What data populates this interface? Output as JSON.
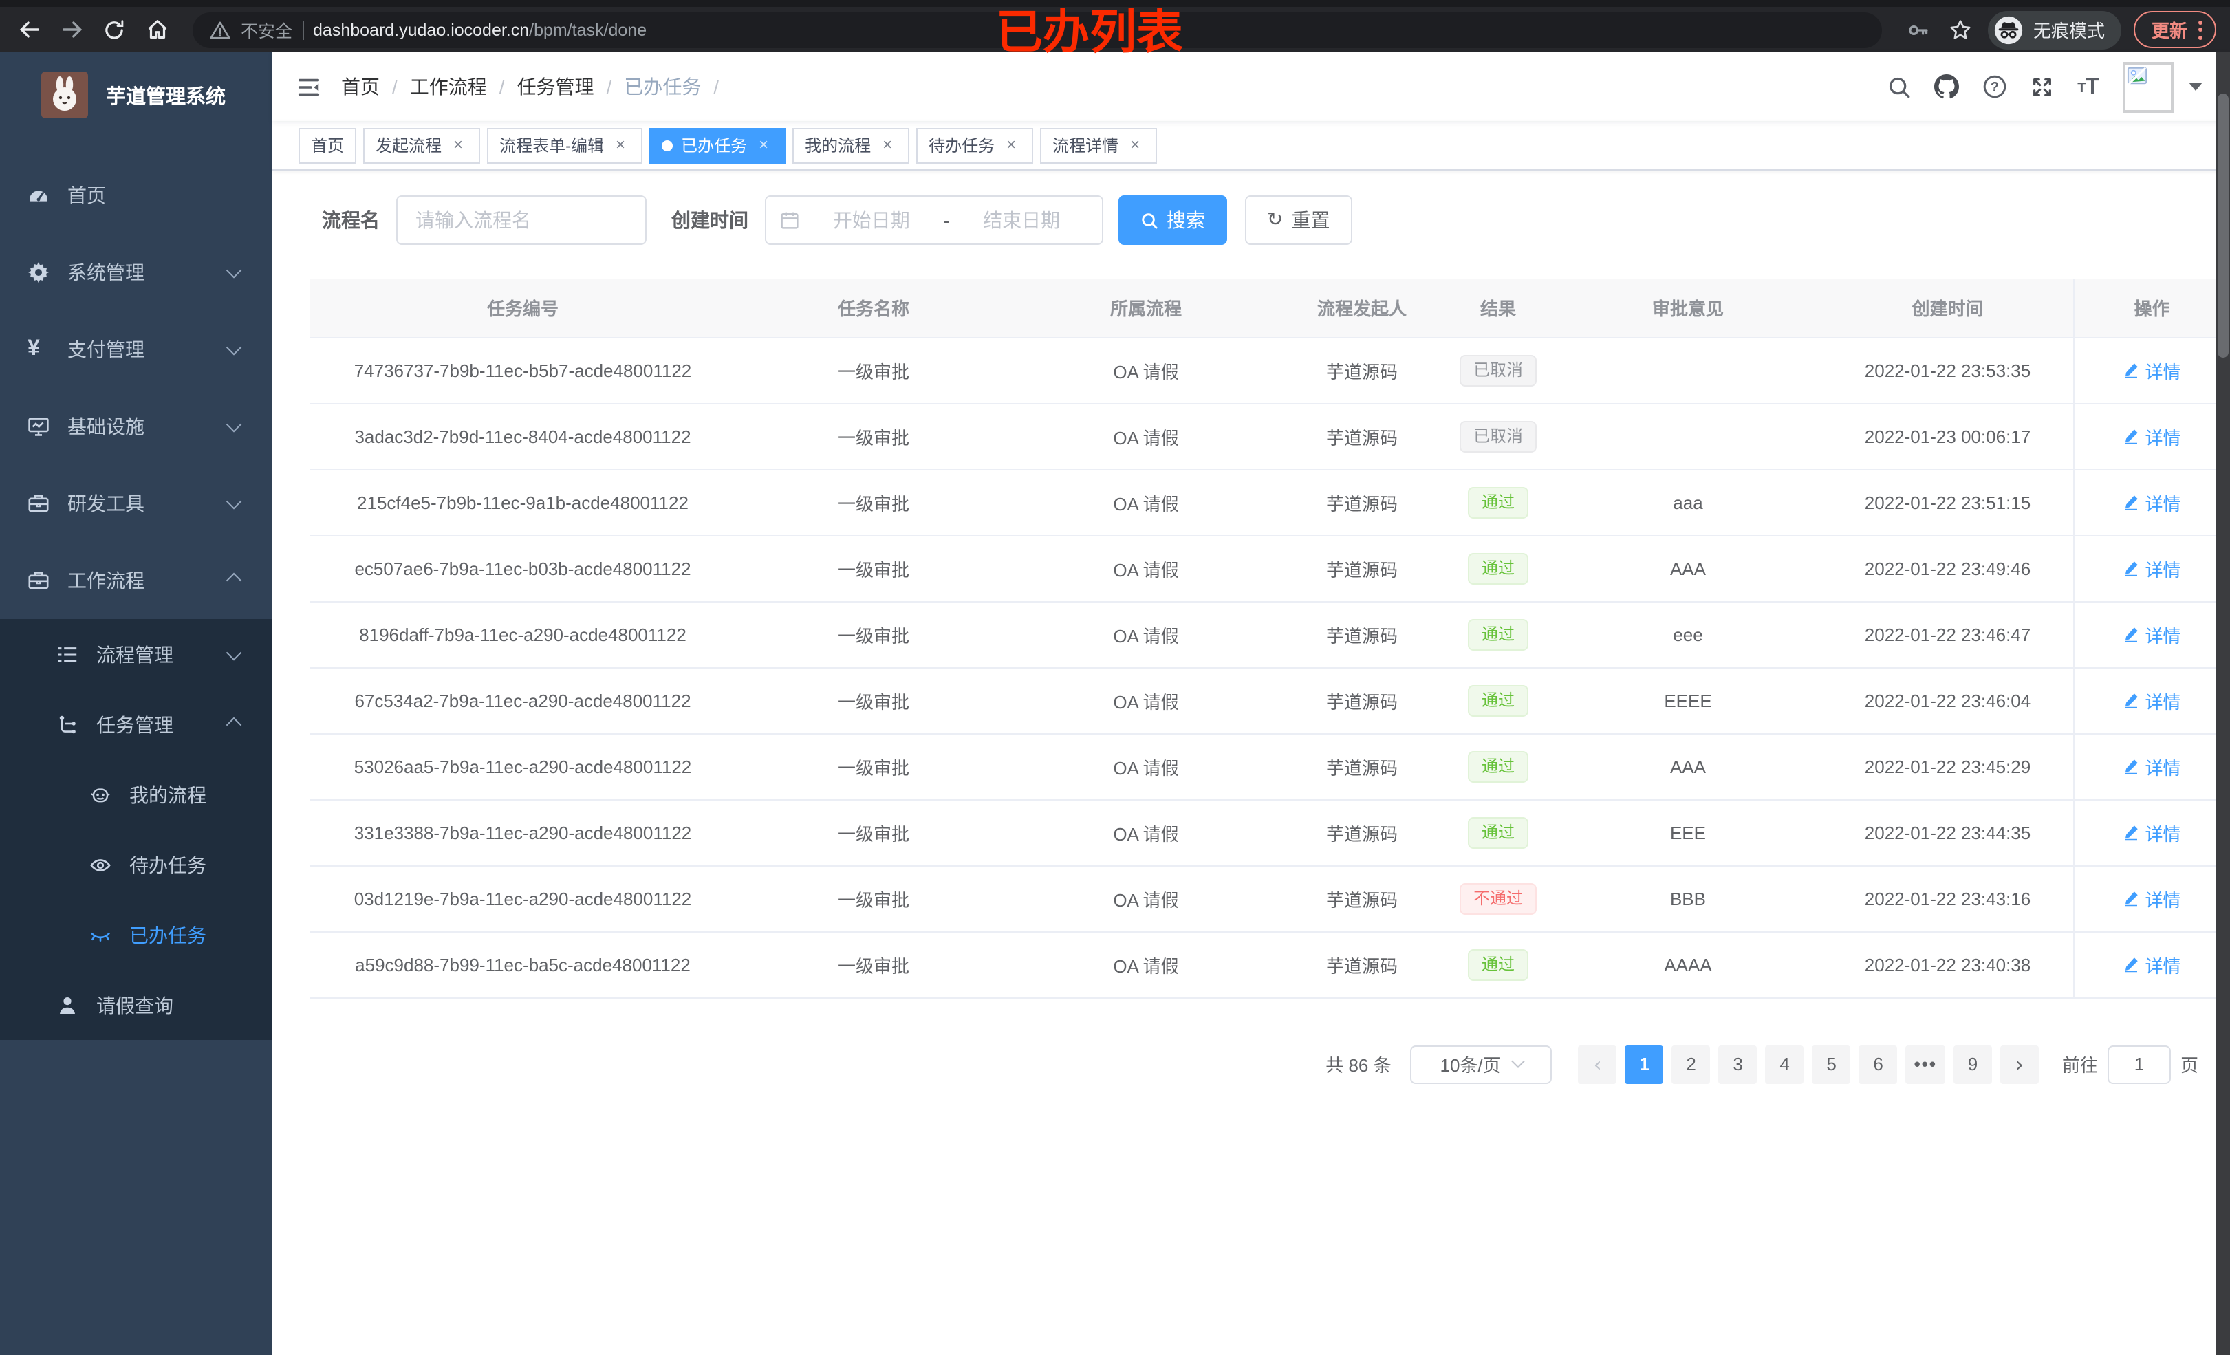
{
  "browser": {
    "security_label": "不安全",
    "url_host": "dashboard.yudao.iocoder.cn",
    "url_path": "/bpm/task/done",
    "incognito_label": "无痕模式",
    "update_label": "更新",
    "annotation": "已办列表",
    "icons": [
      "back",
      "forward",
      "reload",
      "home",
      "warning",
      "key",
      "star",
      "incognito",
      "menu-dots"
    ]
  },
  "colors": {
    "accent": "#409eff",
    "success": "#67c23a",
    "danger": "#f56c6c",
    "info": "#909399",
    "annotation_red": "#fb2a00",
    "sidebar_bg": "#304156",
    "submenu_bg": "#1f2d3d",
    "update_coral": "#f28b82"
  },
  "sidebar": {
    "title": "芋道管理系统",
    "items": [
      {
        "label": "首页",
        "icon": "dashboard",
        "level": "lvl1"
      },
      {
        "label": "系统管理",
        "icon": "gear",
        "level": "lvl1",
        "arrow": "down"
      },
      {
        "label": "支付管理",
        "icon": "yen",
        "level": "lvl1",
        "arrow": "down"
      },
      {
        "label": "基础设施",
        "icon": "monitor",
        "level": "lvl1",
        "arrow": "down"
      },
      {
        "label": "研发工具",
        "icon": "toolbox",
        "level": "lvl1",
        "arrow": "down"
      },
      {
        "label": "工作流程",
        "icon": "toolbox",
        "level": "lvl1",
        "arrow": "up"
      },
      {
        "label": "流程管理",
        "icon": "list",
        "level": "lvl2",
        "dark": "dark",
        "arrow": "down"
      },
      {
        "label": "任务管理",
        "icon": "tree",
        "level": "lvl2",
        "dark": "dark",
        "arrow": "up"
      },
      {
        "label": "我的流程",
        "icon": "robot",
        "level": "lvl3",
        "dark": "dark"
      },
      {
        "label": "待办任务",
        "icon": "eye",
        "level": "lvl3",
        "dark": "dark"
      },
      {
        "label": "已办任务",
        "icon": "eye-closed",
        "level": "lvl3",
        "dark": "dark",
        "state": "active"
      },
      {
        "label": "请假查询",
        "icon": "user",
        "level": "lvl2",
        "dark": "dark"
      }
    ]
  },
  "header": {
    "breadcrumb": [
      {
        "label": "首页"
      },
      {
        "label": "工作流程"
      },
      {
        "label": "任务管理"
      },
      {
        "label": "已办任务",
        "state": "current"
      }
    ],
    "icons": [
      "collapse-menu",
      "search",
      "github",
      "help",
      "fullscreen",
      "font-size",
      "avatar",
      "caret-down"
    ]
  },
  "tabs": [
    {
      "label": "首页"
    },
    {
      "label": "发起流程",
      "closable": true
    },
    {
      "label": "流程表单-编辑",
      "closable": true
    },
    {
      "label": "已办任务",
      "closable": true,
      "state": "active"
    },
    {
      "label": "我的流程",
      "closable": true
    },
    {
      "label": "待办任务",
      "closable": true
    },
    {
      "label": "流程详情",
      "closable": true
    }
  ],
  "filters": {
    "name_label": "流程名",
    "name_placeholder": "请输入流程名",
    "time_label": "创建时间",
    "start_placeholder": "开始日期",
    "range_separator": "-",
    "end_placeholder": "结束日期",
    "search_label": "搜索",
    "reset_label": "重置"
  },
  "table": {
    "columns": [
      {
        "label": "任务编号"
      },
      {
        "label": "任务名称"
      },
      {
        "label": "所属流程"
      },
      {
        "label": "流程发起人"
      },
      {
        "label": "结果"
      },
      {
        "label": "审批意见"
      },
      {
        "label": "创建时间"
      },
      {
        "label": "操作"
      }
    ],
    "action_label": "详情",
    "rows": [
      {
        "id": "74736737-7b9b-11ec-b5b7-acde48001122",
        "name": "一级审批",
        "process": "OA 请假",
        "starter": "芋道源码",
        "result": "已取消",
        "result_type": "info",
        "comment": "",
        "time": "2022-01-22 23:53:35"
      },
      {
        "id": "3adac3d2-7b9d-11ec-8404-acde48001122",
        "name": "一级审批",
        "process": "OA 请假",
        "starter": "芋道源码",
        "result": "已取消",
        "result_type": "info",
        "comment": "",
        "time": "2022-01-23 00:06:17"
      },
      {
        "id": "215cf4e5-7b9b-11ec-9a1b-acde48001122",
        "name": "一级审批",
        "process": "OA 请假",
        "starter": "芋道源码",
        "result": "通过",
        "result_type": "success",
        "comment": "aaa",
        "time": "2022-01-22 23:51:15"
      },
      {
        "id": "ec507ae6-7b9a-11ec-b03b-acde48001122",
        "name": "一级审批",
        "process": "OA 请假",
        "starter": "芋道源码",
        "result": "通过",
        "result_type": "success",
        "comment": "AAA",
        "time": "2022-01-22 23:49:46"
      },
      {
        "id": "8196daff-7b9a-11ec-a290-acde48001122",
        "name": "一级审批",
        "process": "OA 请假",
        "starter": "芋道源码",
        "result": "通过",
        "result_type": "success",
        "comment": "eee",
        "time": "2022-01-22 23:46:47"
      },
      {
        "id": "67c534a2-7b9a-11ec-a290-acde48001122",
        "name": "一级审批",
        "process": "OA 请假",
        "starter": "芋道源码",
        "result": "通过",
        "result_type": "success",
        "comment": "EEEE",
        "time": "2022-01-22 23:46:04"
      },
      {
        "id": "53026aa5-7b9a-11ec-a290-acde48001122",
        "name": "一级审批",
        "process": "OA 请假",
        "starter": "芋道源码",
        "result": "通过",
        "result_type": "success",
        "comment": "AAA",
        "time": "2022-01-22 23:45:29"
      },
      {
        "id": "331e3388-7b9a-11ec-a290-acde48001122",
        "name": "一级审批",
        "process": "OA 请假",
        "starter": "芋道源码",
        "result": "通过",
        "result_type": "success",
        "comment": "EEE",
        "time": "2022-01-22 23:44:35"
      },
      {
        "id": "03d1219e-7b9a-11ec-a290-acde48001122",
        "name": "一级审批",
        "process": "OA 请假",
        "starter": "芋道源码",
        "result": "不通过",
        "result_type": "danger",
        "comment": "BBB",
        "time": "2022-01-22 23:43:16"
      },
      {
        "id": "a59c9d88-7b99-11ec-ba5c-acde48001122",
        "name": "一级审批",
        "process": "OA 请假",
        "starter": "芋道源码",
        "result": "通过",
        "result_type": "success",
        "comment": "AAAA",
        "time": "2022-01-22 23:40:38"
      }
    ]
  },
  "pagination": {
    "total": "共 86 条",
    "page_size": "10条/页",
    "prev": "‹",
    "next": "›",
    "pages": [
      {
        "label": "1",
        "state": "active"
      },
      {
        "label": "2"
      },
      {
        "label": "3"
      },
      {
        "label": "4"
      },
      {
        "label": "5"
      },
      {
        "label": "6"
      },
      {
        "label": "•••",
        "state": "ellipsis"
      },
      {
        "label": "9"
      }
    ],
    "goto_label": "前往",
    "goto_value": "1",
    "unit": "页"
  }
}
